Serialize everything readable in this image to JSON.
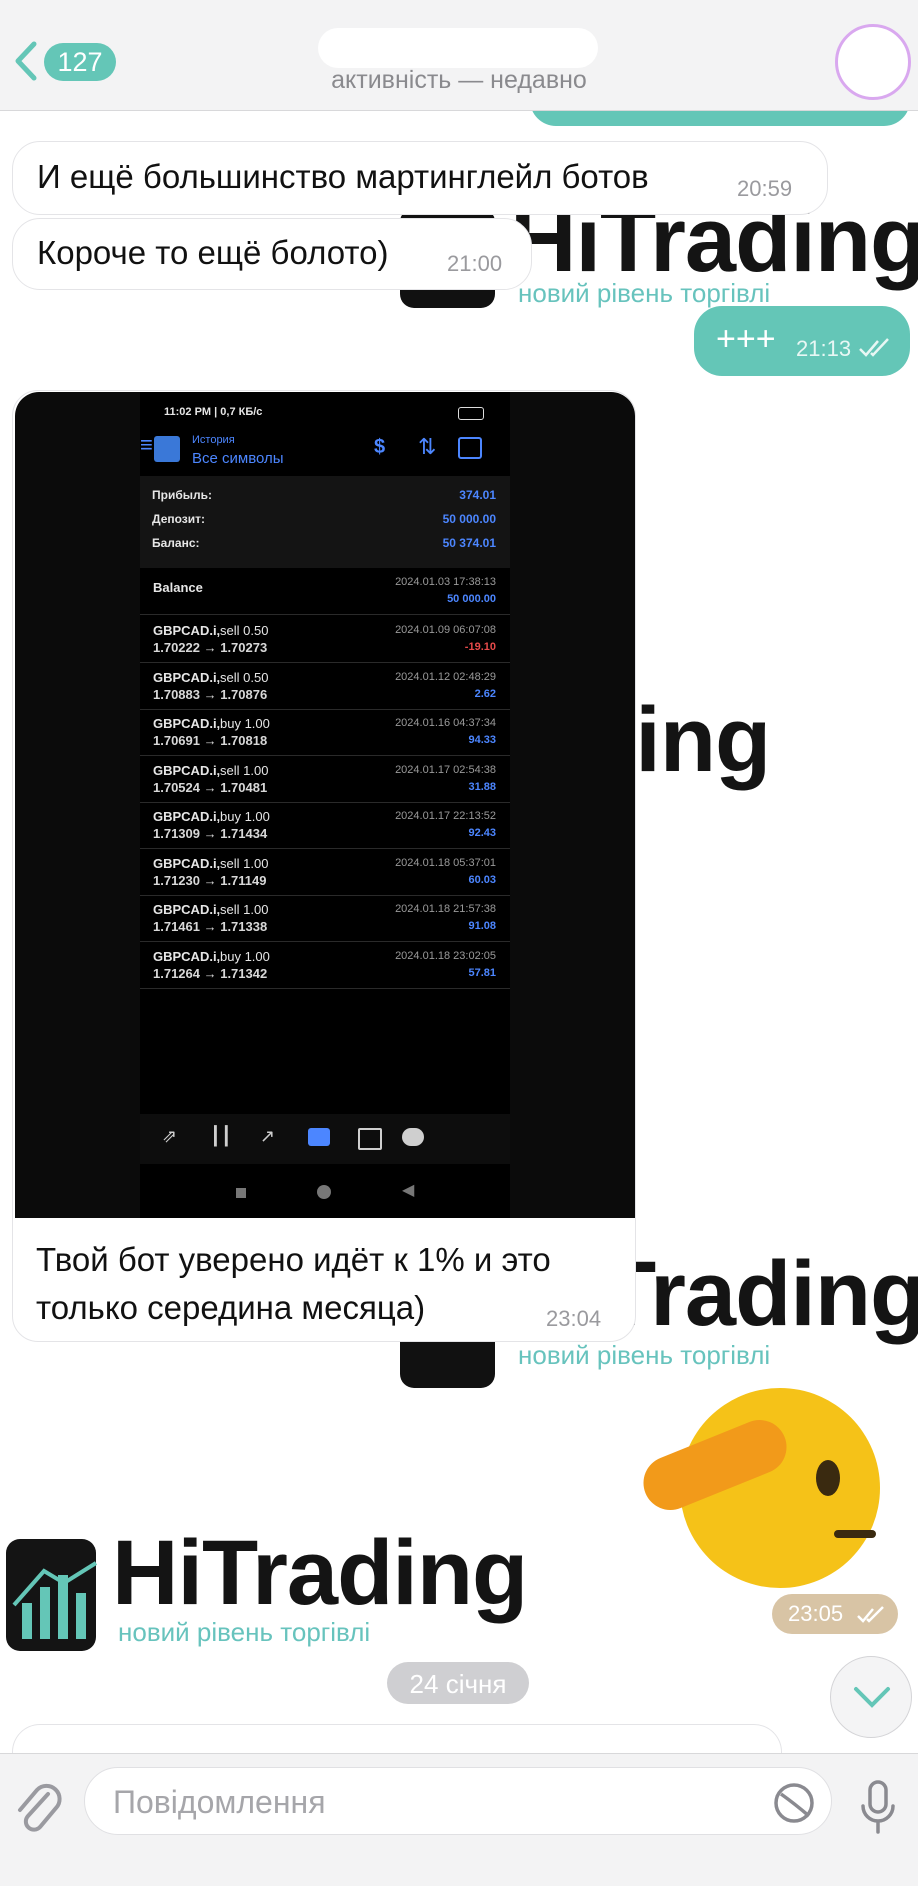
{
  "header": {
    "back_count": "127",
    "status": "активність — недавно"
  },
  "watermark": {
    "brand": "HiTrading",
    "tagline": "новий рівень торгівлі"
  },
  "messages": [
    {
      "text": "И ещё большинство мартинглейл ботов",
      "time": "20:59",
      "direction": "in"
    },
    {
      "text": "Короче то ещё болото)",
      "time": "21:00",
      "direction": "in"
    },
    {
      "text": "+++",
      "time": "21:13",
      "direction": "out"
    },
    {
      "text": "Твой бот уверено идёт к 1% и это только середина месяца)",
      "time": "23:04",
      "direction": "in"
    },
    {
      "text": "",
      "time": "23:05",
      "direction": "out"
    }
  ],
  "screenshot": {
    "statusbar_left": "11:02 PM | 0,7 КБ/с",
    "toolbar_small": "История",
    "toolbar_main": "Все символы",
    "summary": [
      {
        "label": "Прибыль:",
        "value": "374.01"
      },
      {
        "label": "Депозит:",
        "value": "50 000.00"
      },
      {
        "label": "Баланс:",
        "value": "50 374.01"
      }
    ],
    "balance_row": {
      "label": "Balance",
      "date": "2024.01.03 17:38:13",
      "amount": "50 000.00"
    },
    "trades": [
      {
        "sym": "GBPCAD.i,",
        "side": "sell 0.50",
        "prices": "1.70222 → 1.70273",
        "date": "2024.01.09 06:07:08",
        "profit": "-19.10"
      },
      {
        "sym": "GBPCAD.i,",
        "side": "sell 0.50",
        "prices": "1.70883 → 1.70876",
        "date": "2024.01.12 02:48:29",
        "profit": "2.62"
      },
      {
        "sym": "GBPCAD.i,",
        "side": "buy 1.00",
        "prices": "1.70691 → 1.70818",
        "date": "2024.01.16 04:37:34",
        "profit": "94.33"
      },
      {
        "sym": "GBPCAD.i,",
        "side": "sell 1.00",
        "prices": "1.70524 → 1.70481",
        "date": "2024.01.17 02:54:38",
        "profit": "31.88"
      },
      {
        "sym": "GBPCAD.i,",
        "side": "buy 1.00",
        "prices": "1.71309 → 1.71434",
        "date": "2024.01.17 22:13:52",
        "profit": "92.43"
      },
      {
        "sym": "GBPCAD.i,",
        "side": "sell 1.00",
        "prices": "1.71230 → 1.71149",
        "date": "2024.01.18 05:37:01",
        "profit": "60.03"
      },
      {
        "sym": "GBPCAD.i,",
        "side": "sell 1.00",
        "prices": "1.71461 → 1.71338",
        "date": "2024.01.18 21:57:38",
        "profit": "91.08"
      },
      {
        "sym": "GBPCAD.i,",
        "side": "buy 1.00",
        "prices": "1.71264 → 1.71342",
        "date": "2024.01.18 23:02:05",
        "profit": "57.81"
      }
    ]
  },
  "date_separator": "24 січня",
  "composer": {
    "placeholder": "Повідомлення"
  },
  "colors": {
    "accent": "#64c6b7",
    "sell": "#e64a4a",
    "buy": "#4c86ff"
  }
}
